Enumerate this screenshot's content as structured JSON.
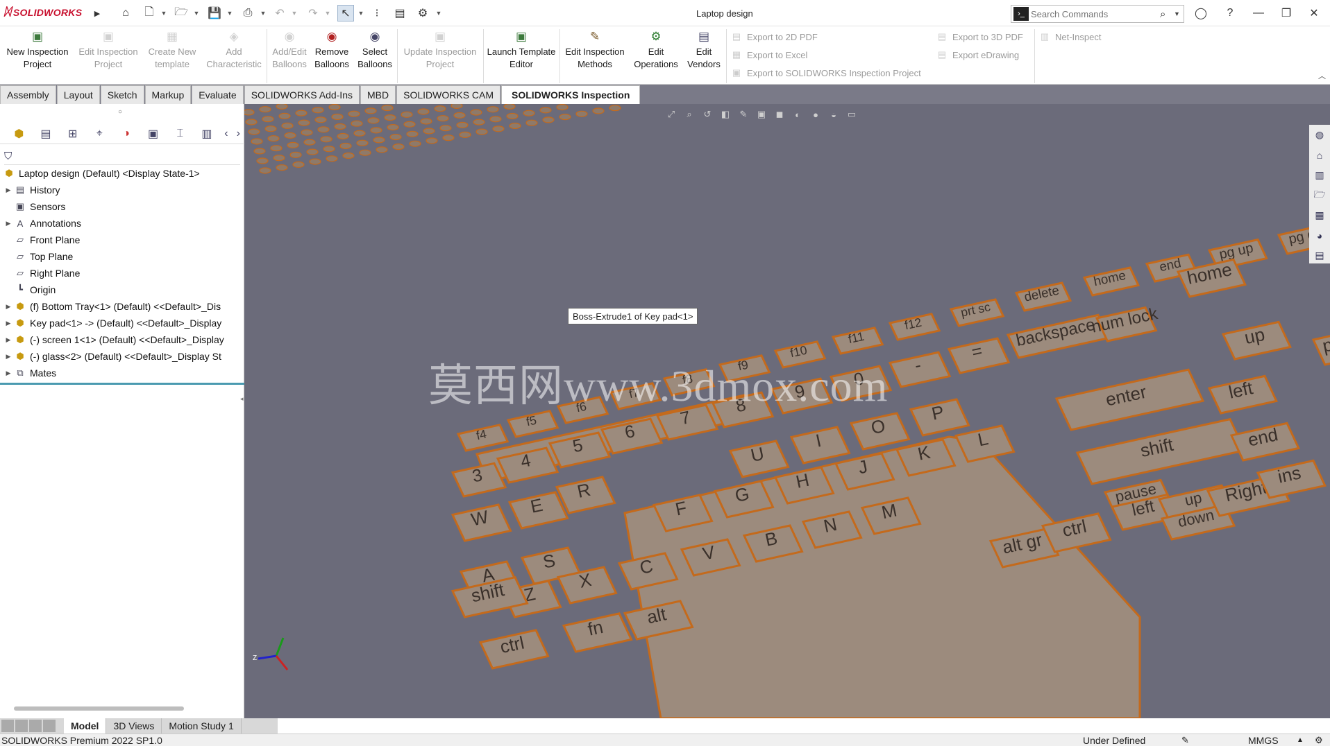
{
  "app": {
    "brand_prefix": "3DS",
    "brand": "SOLIDWORKS",
    "document_title": "Laptop design"
  },
  "search": {
    "placeholder": "Search Commands"
  },
  "ribbon": {
    "buttons": [
      {
        "label": "New Inspection Project",
        "enabled": true,
        "icon": "new-inspection-icon"
      },
      {
        "label": "Edit Inspection Project",
        "enabled": false,
        "icon": "edit-project-icon"
      },
      {
        "label": "Create New template",
        "enabled": false,
        "icon": "new-template-icon"
      },
      {
        "label": "Add Characteristic",
        "enabled": false,
        "icon": "add-characteristic-icon"
      },
      {
        "label": "Add/Edit Balloons",
        "enabled": false,
        "icon": "balloon-icon"
      },
      {
        "label": "Remove Balloons",
        "enabled": true,
        "icon": "remove-balloon-icon"
      },
      {
        "label": "Select Balloons",
        "enabled": true,
        "icon": "select-balloon-icon"
      },
      {
        "label": "Update Inspection Project",
        "enabled": false,
        "icon": "update-project-icon"
      },
      {
        "label": "Launch Template Editor",
        "enabled": true,
        "icon": "template-editor-icon"
      },
      {
        "label": "Edit Inspection Methods",
        "enabled": true,
        "icon": "inspection-methods-icon"
      },
      {
        "label": "Edit Operations",
        "enabled": true,
        "icon": "operations-icon"
      },
      {
        "label": "Edit Vendors",
        "enabled": true,
        "icon": "vendors-icon"
      }
    ],
    "exports": [
      "Export to 2D PDF",
      "Export to Excel",
      "Export to SOLIDWORKS Inspection Project",
      "Export to 3D PDF",
      "Export eDrawing",
      "Net-Inspect"
    ]
  },
  "tabs": [
    "Assembly",
    "Layout",
    "Sketch",
    "Markup",
    "Evaluate",
    "SOLIDWORKS Add-Ins",
    "MBD",
    "SOLIDWORKS CAM",
    "SOLIDWORKS Inspection"
  ],
  "active_tab": "SOLIDWORKS Inspection",
  "tree": [
    {
      "label": "Laptop design (Default) <Display State-1>",
      "level": 0,
      "expand": false,
      "icon": "assembly-icon"
    },
    {
      "label": "History",
      "level": 1,
      "expand": true,
      "icon": "history-icon"
    },
    {
      "label": "Sensors",
      "level": 1,
      "expand": false,
      "icon": "sensor-icon"
    },
    {
      "label": "Annotations",
      "level": 1,
      "expand": true,
      "icon": "annotation-icon"
    },
    {
      "label": "Front Plane",
      "level": 1,
      "expand": false,
      "icon": "plane-icon"
    },
    {
      "label": "Top Plane",
      "level": 1,
      "expand": false,
      "icon": "plane-icon"
    },
    {
      "label": "Right Plane",
      "level": 1,
      "expand": false,
      "icon": "plane-icon"
    },
    {
      "label": "Origin",
      "level": 1,
      "expand": false,
      "icon": "origin-icon"
    },
    {
      "label": "(f) Bottom Tray<1> (Default) <<Default>_Dis",
      "level": 1,
      "expand": true,
      "icon": "part-icon"
    },
    {
      "label": "Key pad<1> -> (Default) <<Default>_Display",
      "level": 1,
      "expand": true,
      "icon": "part-icon"
    },
    {
      "label": "(-) screen 1<1> (Default) <<Default>_Display",
      "level": 1,
      "expand": true,
      "icon": "part-icon"
    },
    {
      "label": "(-) glass<2> (Default) <<Default>_Display St",
      "level": 1,
      "expand": true,
      "icon": "part-icon"
    },
    {
      "label": "Mates",
      "level": 1,
      "expand": true,
      "icon": "mates-icon"
    }
  ],
  "model_tabs": [
    "Model",
    "3D Views",
    "Motion Study 1"
  ],
  "active_model_tab": "Model",
  "viewport": {
    "tooltip": "Boss-Extrude1 of Key pad<1>",
    "watermark": "莫西网www.3dmox.com",
    "keys": [
      "pg dn",
      "pg up",
      "end",
      "home",
      "delete",
      "prt sc",
      "f12",
      "f11",
      "f10",
      "f9",
      "f8",
      "f7",
      "f6",
      "f5",
      "f4",
      "backspace",
      "num lock",
      "=",
      "-",
      "0",
      "9",
      "8",
      "7",
      "6",
      "5",
      "4",
      "3",
      "P",
      "O",
      "I",
      "U",
      "R",
      "W",
      "enter",
      "shift",
      "pause",
      "L",
      "K",
      "J",
      "H",
      "G",
      "F",
      "E",
      "S",
      "A",
      "M",
      "N",
      "B",
      "V",
      "C",
      "X",
      "Z",
      "alt gr",
      "ctrl",
      "alt",
      "fn",
      "ctrl",
      "shift",
      "left",
      "up",
      "down",
      "Right",
      "home",
      "up",
      "pg up",
      "left",
      "end",
      "ins"
    ],
    "background": "#6b6b7a",
    "key_fill": "#9c8b7d",
    "key_edge": "#c46a1c"
  },
  "status": {
    "product": "SOLIDWORKS Premium 2022 SP1.0",
    "state": "Under Defined",
    "units": "MMGS"
  }
}
